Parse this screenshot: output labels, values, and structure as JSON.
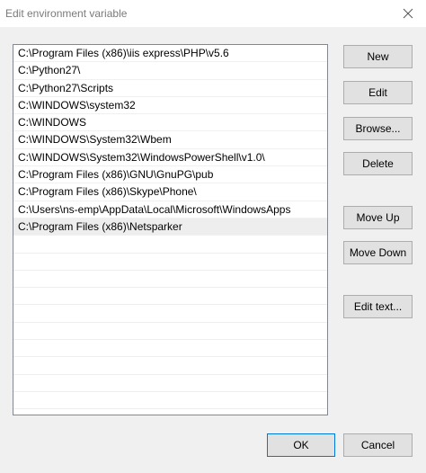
{
  "window": {
    "title": "Edit environment variable"
  },
  "list": {
    "items": [
      "C:\\Program Files (x86)\\iis express\\PHP\\v5.6",
      "C:\\Python27\\",
      "C:\\Python27\\Scripts",
      "C:\\WINDOWS\\system32",
      "C:\\WINDOWS",
      "C:\\WINDOWS\\System32\\Wbem",
      "C:\\WINDOWS\\System32\\WindowsPowerShell\\v1.0\\",
      "C:\\Program Files (x86)\\GNU\\GnuPG\\pub",
      "C:\\Program Files (x86)\\Skype\\Phone\\",
      "C:\\Users\\ns-emp\\AppData\\Local\\Microsoft\\WindowsApps",
      "C:\\Program Files (x86)\\Netsparker"
    ],
    "selected_index": 10
  },
  "buttons": {
    "new": "New",
    "edit": "Edit",
    "browse": "Browse...",
    "delete": "Delete",
    "move_up": "Move Up",
    "move_down": "Move Down",
    "edit_text": "Edit text...",
    "ok": "OK",
    "cancel": "Cancel"
  }
}
